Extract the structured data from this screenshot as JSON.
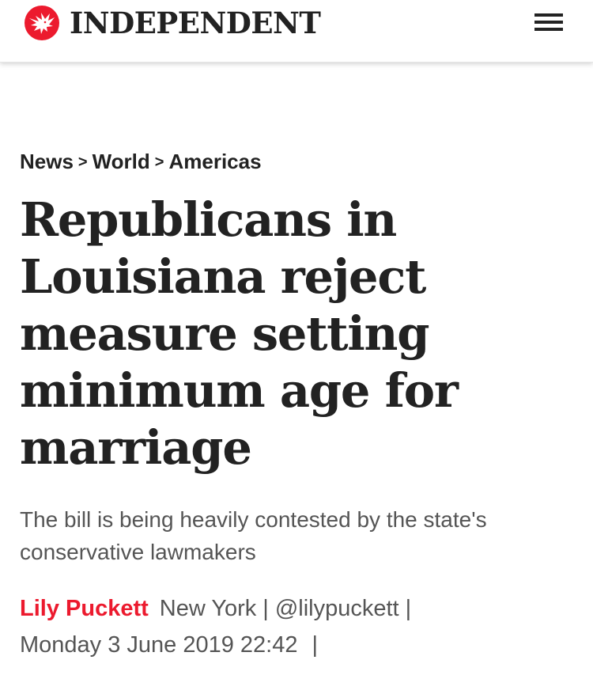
{
  "header": {
    "logo_text": "INDEPENDENT",
    "logo_icon": "eagle-icon",
    "menu_icon": "hamburger-menu-icon",
    "brand_color": "#ec1a2e"
  },
  "breadcrumb": {
    "items": [
      "News",
      "World",
      "Americas"
    ],
    "separator": ">"
  },
  "article": {
    "headline": "Republicans in Louisiana reject measure setting minimum age for marriage",
    "standfirst": "The bill is being heavily contested by the state's conservative lawmakers",
    "author": "Lily Puckett",
    "location": "New York",
    "twitter_handle": "@lilypuckett",
    "date": "Monday 3 June 2019 22:42",
    "pipe": "|"
  }
}
